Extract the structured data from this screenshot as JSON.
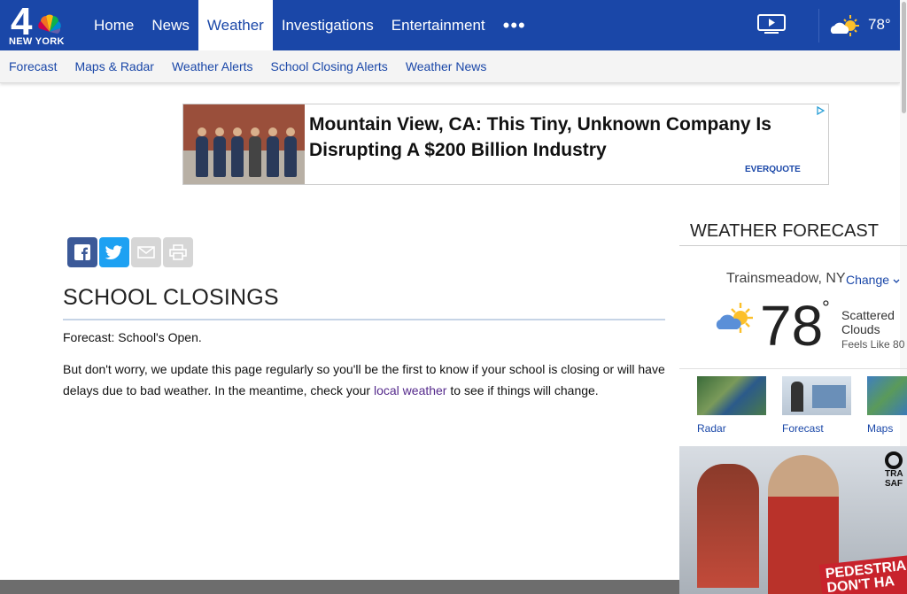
{
  "brand": {
    "logo_number": "4",
    "logo_sub": "NEW YORK"
  },
  "nav": {
    "items": [
      {
        "label": "Home"
      },
      {
        "label": "News"
      },
      {
        "label": "Weather",
        "active": true
      },
      {
        "label": "Investigations"
      },
      {
        "label": "Entertainment"
      }
    ],
    "more": "•••"
  },
  "header_weather": {
    "temp": "78°",
    "icon": "partly-cloudy-icon"
  },
  "subnav": {
    "items": [
      {
        "label": "Forecast"
      },
      {
        "label": "Maps & Radar"
      },
      {
        "label": "Weather Alerts"
      },
      {
        "label": "School Closing Alerts"
      },
      {
        "label": "Weather News"
      }
    ]
  },
  "ad": {
    "headline_line1": "Mountain View, CA: This Tiny, Unknown Company Is",
    "headline_line2": "Disrupting A $200 Billion Industry",
    "brand": "EVERQUOTE"
  },
  "share": {
    "icons": [
      "facebook-icon",
      "twitter-icon",
      "email-icon",
      "print-icon"
    ]
  },
  "article": {
    "title": "SCHOOL CLOSINGS",
    "p1": "Forecast: School's Open.",
    "p2_before": "But don't worry, we update this page regularly so you'll be the first to know if your school is closing or will have delays due to bad weather. In the meantime, check your ",
    "p2_link": "local weather",
    "p2_after": " to see if things will change."
  },
  "forecast": {
    "title": "WEATHER FORECAST",
    "location": "Trainsmeadow, NY",
    "change": "Change",
    "temp": "78",
    "deg": "°",
    "condition_line1": "Scattered",
    "condition_line2": "Clouds",
    "feels_like": "Feels Like 80 °",
    "thumbs": [
      {
        "label": "Radar"
      },
      {
        "label": "Forecast"
      },
      {
        "label": "Maps"
      }
    ]
  },
  "sidebar_ad": {
    "text": "PEDESTRIA",
    "text2": "DON'T HA",
    "logo_text": "TRA SAF"
  },
  "colors": {
    "brand_blue": "#1a47a8",
    "facebook": "#3b5998",
    "twitter": "#1da1f2"
  }
}
